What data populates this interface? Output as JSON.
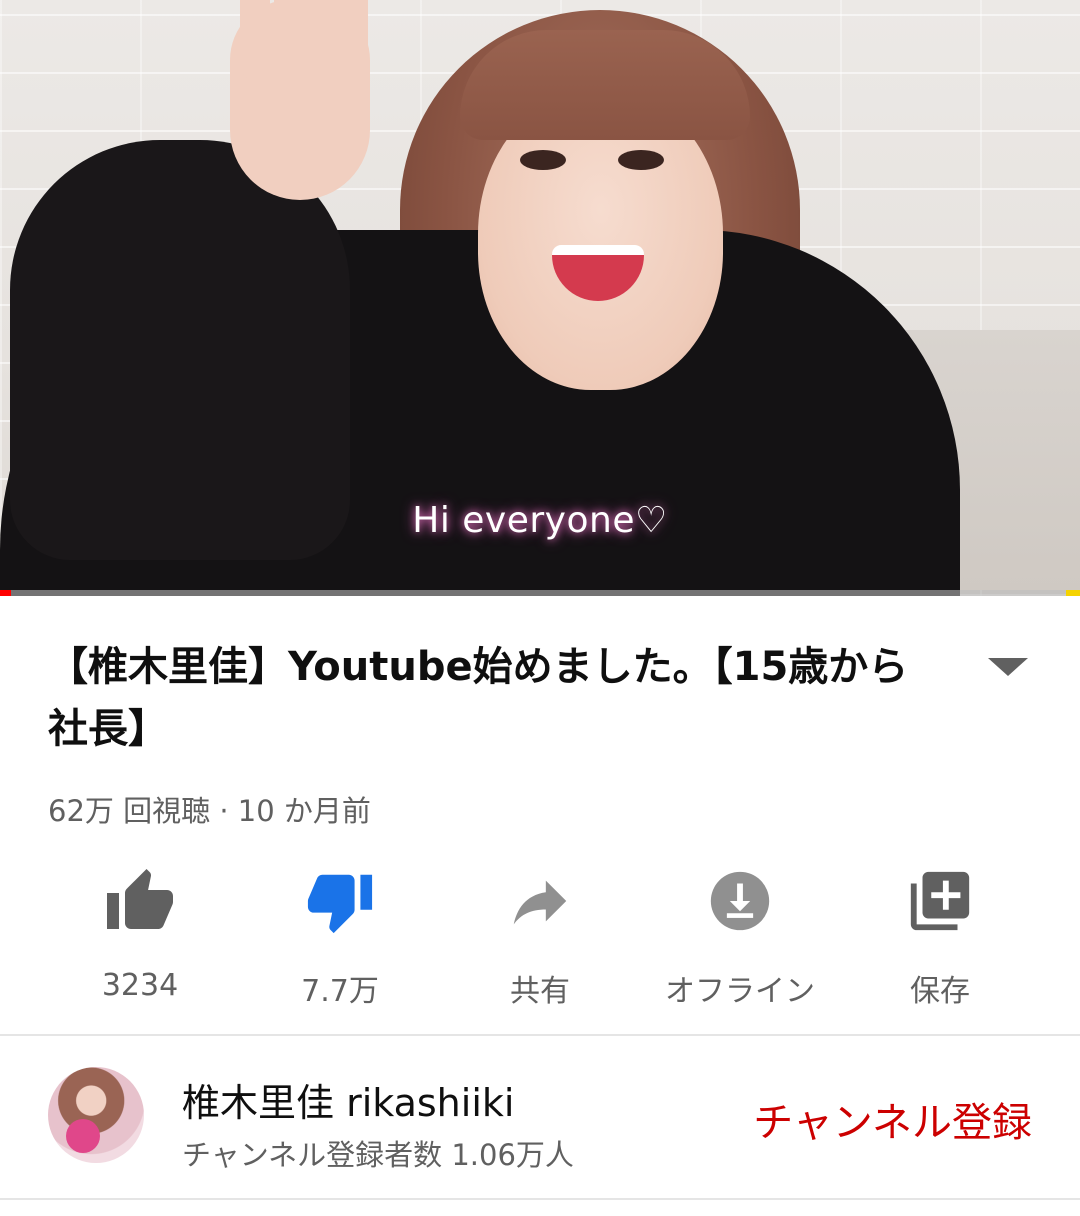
{
  "video": {
    "overlay_caption": "Hi everyone♡",
    "progress": 0.01,
    "accent_color": "#ff0000"
  },
  "details": {
    "title": "【椎木里佳】Youtube始めました。【15歳から社長】",
    "meta": "62万 回視聴 · 10 か月前",
    "expand_icon": "chevron-down-icon"
  },
  "actions": [
    {
      "icon": "thumbs-up-icon",
      "label": "3234",
      "color": "#606060"
    },
    {
      "icon": "thumbs-down-icon",
      "label": "7.7万",
      "color": "#1a73e8"
    },
    {
      "icon": "share-icon",
      "label": "共有",
      "color": "#909090"
    },
    {
      "icon": "download-icon",
      "label": "オフライン",
      "color": "#909090"
    },
    {
      "icon": "add-to-playlist-icon",
      "label": "保存",
      "color": "#606060"
    }
  ],
  "channel": {
    "name": "椎木里佳 rikashiiki",
    "subscribers": "チャンネル登録者数 1.06万人",
    "subscribe_label": "チャンネル登録",
    "subscribe_color": "#cc0000"
  }
}
